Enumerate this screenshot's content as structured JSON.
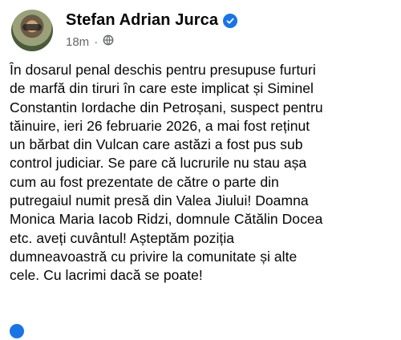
{
  "post": {
    "author": "Stefan Adrian Jurca",
    "time": "18m",
    "separator": "·",
    "text": "În dosarul penal deschis pentru presupuse furturi\nde marfă din tiruri în care este implicat și Siminel\nConstantin Iordache din Petroșani, suspect pentru\ntăinuire, ieri 26 februarie 2026, a mai fost reținut\nun bărbat din Vulcan care astăzi a fost pus sub\ncontrol judiciar. Se pare că lucrurile nu stau așa\ncum au fost prezentate de către o parte din\nputregaiul numit presă din Valea Jiului! Doamna\nMonica Maria Iacob Ridzi, domnule Cătălin Docea\netc. aveți cuvântul! Așteptăm poziția\ndumneavoastră cu privire la comunitate și alte\ncele. Cu lacrimi dacă se poate!"
  },
  "icons": {
    "verified": "verified-badge-icon",
    "audience": "globe-icon"
  },
  "colors": {
    "accent": "#1b74e4",
    "secondary_text": "#65676b"
  }
}
